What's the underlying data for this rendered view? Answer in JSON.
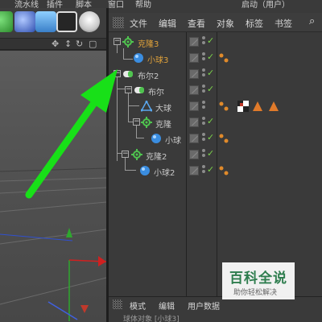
{
  "menubar": {
    "items": [
      "流水线",
      "插件",
      "脚本",
      "窗口",
      "帮助"
    ],
    "right_label": "启动（用户）"
  },
  "object_manager": {
    "menu": [
      "文件",
      "编辑",
      "查看",
      "对象",
      "标签",
      "书签"
    ],
    "objects": [
      {
        "name": "克隆3",
        "icon": "cloner-icon",
        "color": "#e0a23a",
        "selected": true
      },
      {
        "name": "小球3",
        "icon": "sphere-icon",
        "color": "#e0a23a",
        "selected": true
      },
      {
        "name": "布尔2",
        "icon": "boole-icon",
        "color": "#c8c8c8"
      },
      {
        "name": "布尔",
        "icon": "boole-icon",
        "color": "#c8c8c8"
      },
      {
        "name": "大球",
        "icon": "sphere-icon",
        "color": "#c8c8c8"
      },
      {
        "name": "克隆",
        "icon": "cloner-icon",
        "color": "#c8c8c8"
      },
      {
        "name": "小球",
        "icon": "sphere-icon",
        "color": "#c8c8c8"
      },
      {
        "name": "克隆2",
        "icon": "cloner-icon",
        "color": "#c8c8c8"
      },
      {
        "name": "小球2",
        "icon": "sphere-icon",
        "color": "#c8c8c8"
      }
    ]
  },
  "attribute_manager": {
    "menu": [
      "模式",
      "编辑",
      "用户数据"
    ],
    "subtitle": "球体对象 [小球3]"
  },
  "watermark": {
    "title": "百科全说",
    "subtitle": "助你轻松解决"
  },
  "colors": {
    "accent_selected": "#e0a23a",
    "arrow": "#18e018",
    "check": "#7bd24a"
  }
}
